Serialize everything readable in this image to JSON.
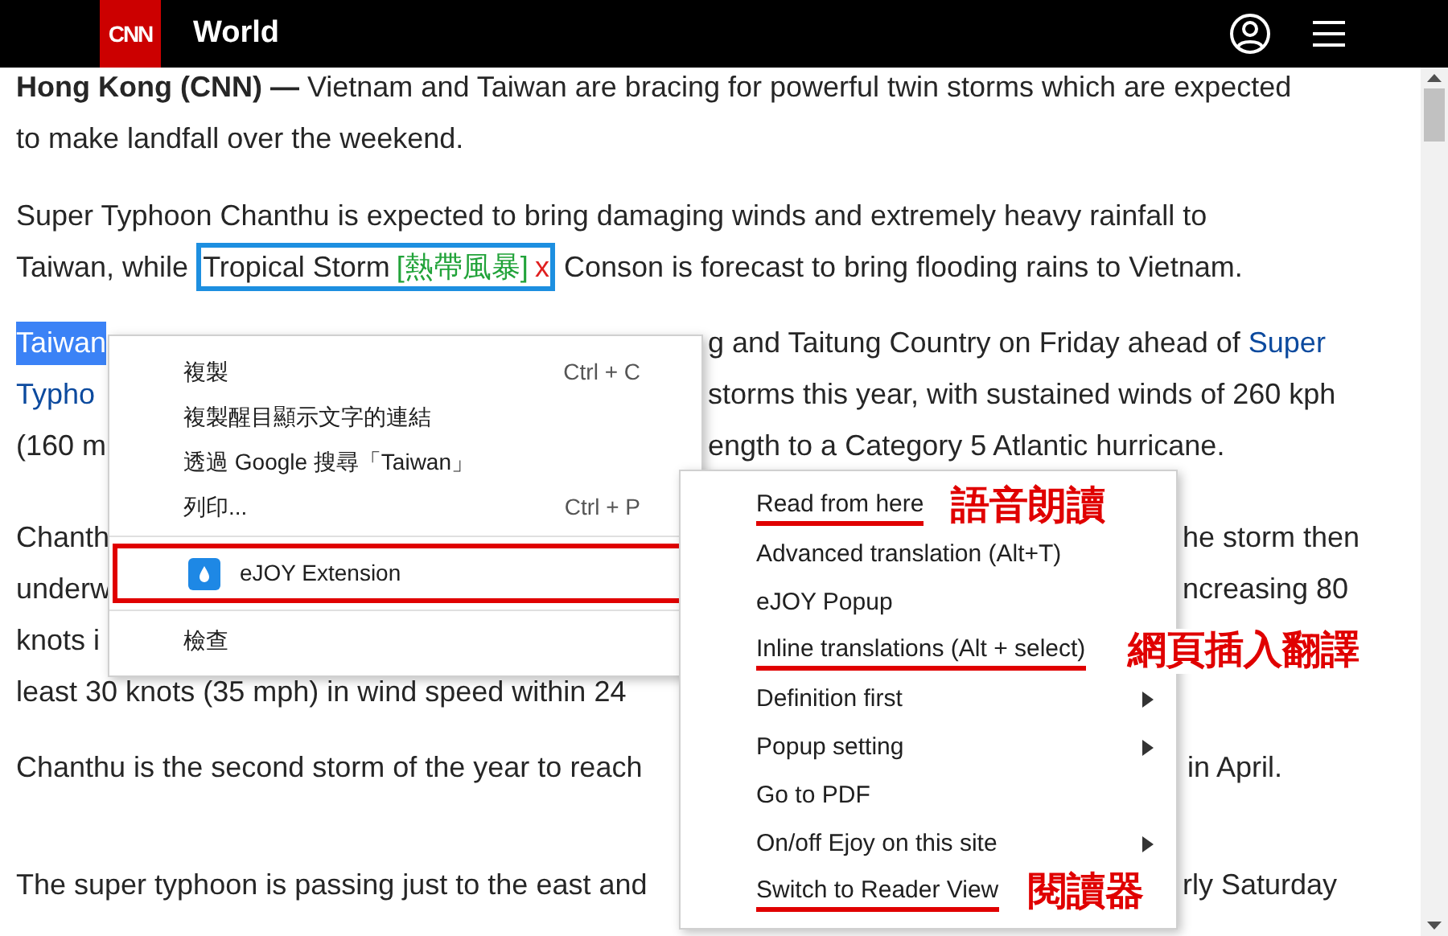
{
  "header": {
    "logo_text": "CNN",
    "section": "World"
  },
  "article": [
    {
      "lines": [
        {
          "left": [
            {
              "kind": "bold",
              "text": "Hong Kong (CNN) —"
            },
            {
              "kind": "plain",
              "text": " Vietnam and Taiwan are bracing for powerful twin storms which are expected"
            }
          ]
        },
        {
          "left": [
            {
              "kind": "plain",
              "text": "to make landfall over the weekend."
            }
          ]
        }
      ]
    },
    {
      "lines": [
        {
          "left": [
            {
              "kind": "plain",
              "text": "Super Typhoon Chanthu is expected to bring damaging winds and extremely heavy rainfall to"
            }
          ]
        },
        {
          "left": [
            {
              "kind": "plain",
              "text": "Taiwan, while "
            },
            {
              "kind": "boxed",
              "text": "Tropical Storm",
              "gloss": "[熱帶風暴]",
              "remove": "x"
            },
            {
              "kind": "plain",
              "text": " Conson is forecast to bring flooding rains to Vietnam."
            }
          ]
        }
      ]
    },
    {
      "lines": [
        {
          "left": [
            {
              "kind": "highlight",
              "text": "Taiwan"
            }
          ],
          "right": [
            {
              "kind": "plain",
              "text": "g and Taitung Country on Friday ahead of "
            },
            {
              "kind": "link",
              "text": "Super"
            }
          ]
        },
        {
          "left": [
            {
              "kind": "link",
              "text": "Typho"
            }
          ],
          "right": [
            {
              "kind": "plain",
              "text": "storms this year, with sustained winds of 260 kph"
            }
          ]
        },
        {
          "left": [
            {
              "kind": "plain",
              "text": "(160 m"
            }
          ],
          "right": [
            {
              "kind": "plain",
              "text": "ength to a Category 5 Atlantic hurricane."
            }
          ]
        }
      ]
    },
    {
      "lines": [
        {
          "left": [
            {
              "kind": "plain",
              "text": "Chanth"
            }
          ],
          "right": [
            {
              "kind": "plain",
              "text": "he storm then"
            }
          ]
        },
        {
          "left": [
            {
              "kind": "plain",
              "text": "underw"
            }
          ],
          "right": [
            {
              "kind": "plain",
              "text": "ncreasing 80"
            }
          ]
        },
        {
          "left": [
            {
              "kind": "plain",
              "text": "knots i"
            }
          ]
        },
        {
          "left": [
            {
              "kind": "plain",
              "text": "least 30 knots (35 mph) in wind speed within 24"
            }
          ]
        }
      ]
    },
    {
      "lines": [
        {
          "left": [
            {
              "kind": "plain",
              "text": "Chanthu is the second storm of the year to reach"
            }
          ],
          "right": [
            {
              "kind": "plain",
              "text": "in April."
            }
          ]
        }
      ]
    },
    {
      "lines": [
        {
          "left": [
            {
              "kind": "plain",
              "text": "The super typhoon is passing just to the east and"
            }
          ],
          "right": [
            {
              "kind": "plain",
              "text": "rly Saturday"
            }
          ]
        }
      ]
    }
  ],
  "context_menu": {
    "groups": [
      [
        {
          "label": "複製",
          "shortcut": "Ctrl + C"
        },
        {
          "label": "複製醒目顯示文字的連結"
        },
        {
          "label": "透過 Google 搜尋「Taiwan」"
        },
        {
          "label": "列印...",
          "shortcut": "Ctrl + P"
        }
      ],
      [
        {
          "label": "eJOY Extension",
          "icon": true,
          "marked": true
        }
      ],
      [
        {
          "label": "檢查"
        }
      ]
    ]
  },
  "submenu": [
    {
      "label": "Read from here",
      "underlined": true,
      "has_submenu": false,
      "note": "語音朗讀"
    },
    {
      "label": "Advanced translation (Alt+T)",
      "underlined": false,
      "has_submenu": false
    },
    {
      "label": "eJOY Popup",
      "underlined": false,
      "has_submenu": false
    },
    {
      "label": "Inline translations (Alt + select)",
      "underlined": true,
      "has_submenu": false,
      "note": "網頁插入翻譯"
    },
    {
      "label": "Definition first",
      "underlined": false,
      "has_submenu": true
    },
    {
      "label": "Popup setting",
      "underlined": false,
      "has_submenu": true
    },
    {
      "label": "Go to PDF",
      "underlined": false,
      "has_submenu": false
    },
    {
      "label": "On/off Ejoy on this site",
      "underlined": false,
      "has_submenu": true
    },
    {
      "label": "Switch to Reader View",
      "underlined": true,
      "has_submenu": false,
      "note": "閱讀器"
    }
  ]
}
